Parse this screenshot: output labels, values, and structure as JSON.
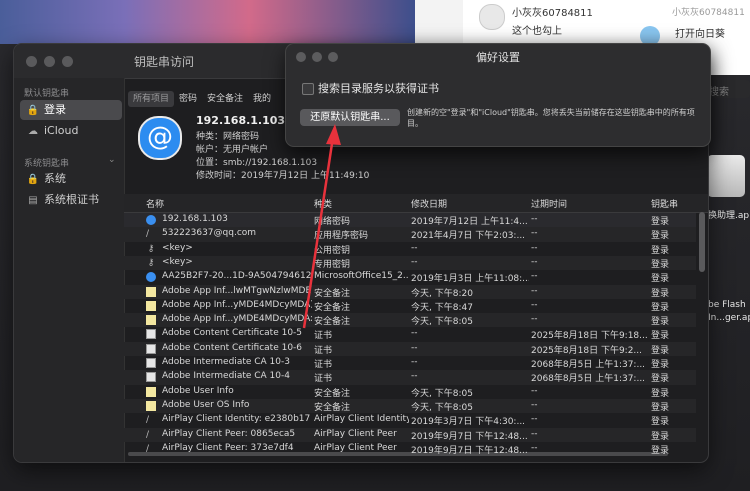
{
  "chat": {
    "user_name": "小灰灰60784811",
    "user_name_right": "小灰灰60784811",
    "snippet": "这个也勾上",
    "open_label": "打开向日葵"
  },
  "desktop": {
    "label1": "换助理.ap",
    "label2": "be Flash",
    "label3": "In...ger.ap"
  },
  "window": {
    "title": "钥匙串访问",
    "sidebar": {
      "section1": "默认钥匙串",
      "items1": [
        {
          "label": "登录",
          "icon": "lock-icon"
        },
        {
          "label": "iCloud",
          "icon": "cloud-icon"
        }
      ],
      "section2": "系统钥匙串",
      "items2": [
        {
          "label": "系统",
          "icon": "lock-icon"
        },
        {
          "label": "系统根证书",
          "icon": "cabinet-icon"
        }
      ]
    },
    "tabs": [
      "所有项目",
      "密码",
      "安全备注",
      "我的"
    ],
    "search_placeholder": "搜索",
    "detail": {
      "title": "192.168.1.103",
      "kind": "种类：网络密码",
      "account": "帐户：无用户帐户",
      "location": "位置：smb://192.168.1.103",
      "modified": "修改时间：2019年7月12日 上午11:49:10"
    },
    "columns": [
      "名称",
      "种类",
      "修改日期",
      "过期时间",
      "钥匙串"
    ],
    "rows": [
      {
        "icon": "at-icon",
        "name": "192.168.1.103",
        "kind": "网络密码",
        "date": "2019年7月12日 上午11:4...",
        "expires": "--",
        "chain": "登录"
      },
      {
        "icon": "pen-icon",
        "name": "532223637@qq.com",
        "kind": "应用程序密码",
        "date": "2021年4月7日 下午2:03:...",
        "expires": "--",
        "chain": "登录"
      },
      {
        "icon": "key-icon",
        "name": "<key>",
        "kind": "公用密钥",
        "date": "--",
        "expires": "--",
        "chain": "登录"
      },
      {
        "icon": "key-icon",
        "name": "<key>",
        "kind": "专用密钥",
        "date": "--",
        "expires": "--",
        "chain": "登录"
      },
      {
        "icon": "at-icon",
        "name": "AA25B2F7-20...1D-9A5047946128",
        "kind": "MicrosoftOffice15_2...",
        "date": "2019年1月3日 上午11:08:...",
        "expires": "--",
        "chain": "登录"
      },
      {
        "icon": "note-icon",
        "name": "Adobe App Inf...lwMTgwNzlwMDE)",
        "kind": "安全备注",
        "date": "今天, 下午8:20",
        "expires": "--",
        "chain": "登录"
      },
      {
        "icon": "note-icon",
        "name": "Adobe App Inf...yMDE4MDcyMDA)",
        "kind": "安全备注",
        "date": "今天, 下午8:47",
        "expires": "--",
        "chain": "登录"
      },
      {
        "icon": "note-icon",
        "name": "Adobe App Inf...yMDE4MDcyMDAx)",
        "kind": "安全备注",
        "date": "今天, 下午8:05",
        "expires": "--",
        "chain": "登录"
      },
      {
        "icon": "cert-icon",
        "name": "Adobe Content Certificate 10-5",
        "kind": "证书",
        "date": "--",
        "expires": "2025年8月18日 下午9:18...",
        "chain": "登录"
      },
      {
        "icon": "cert-icon",
        "name": "Adobe Content Certificate 10-6",
        "kind": "证书",
        "date": "--",
        "expires": "2025年8月18日 下午9:2...",
        "chain": "登录"
      },
      {
        "icon": "cert-icon",
        "name": "Adobe Intermediate CA 10-3",
        "kind": "证书",
        "date": "--",
        "expires": "2068年8月5日 上午1:37:...",
        "chain": "登录"
      },
      {
        "icon": "cert-icon",
        "name": "Adobe Intermediate CA 10-4",
        "kind": "证书",
        "date": "--",
        "expires": "2068年8月5日 上午1:37:...",
        "chain": "登录"
      },
      {
        "icon": "note-icon",
        "name": "Adobe User Info",
        "kind": "安全备注",
        "date": "今天, 下午8:05",
        "expires": "--",
        "chain": "登录"
      },
      {
        "icon": "note-icon",
        "name": "Adobe User OS Info",
        "kind": "安全备注",
        "date": "今天, 下午8:05",
        "expires": "--",
        "chain": "登录"
      },
      {
        "icon": "pen-icon",
        "name": "AirPlay Client Identity: e2380b17",
        "kind": "AirPlay Client Identity",
        "date": "2019年3月7日 下午4:30:...",
        "expires": "--",
        "chain": "登录"
      },
      {
        "icon": "pen-icon",
        "name": "AirPlay Client Peer: 0865eca5",
        "kind": "AirPlay Client Peer",
        "date": "2019年9月7日 下午12:48...",
        "expires": "--",
        "chain": "登录"
      },
      {
        "icon": "pen-icon",
        "name": "AirPlay Client Peer: 373e7df4",
        "kind": "AirPlay Client Peer",
        "date": "2019年9月7日 下午12:48...",
        "expires": "--",
        "chain": "登录"
      }
    ]
  },
  "prefs": {
    "title": "偏好设置",
    "checkbox_label": "搜索目录服务以获得证书",
    "reset_button": "还原默认钥匙串...",
    "reset_description": "创建新的空\"登录\"和\"iCloud\"钥匙串。您将丢失当前储存在这些钥匙串中的所有项目。"
  },
  "colors": {
    "accent_red": "#e8323c",
    "selection_blue": "#2c8cf0"
  }
}
